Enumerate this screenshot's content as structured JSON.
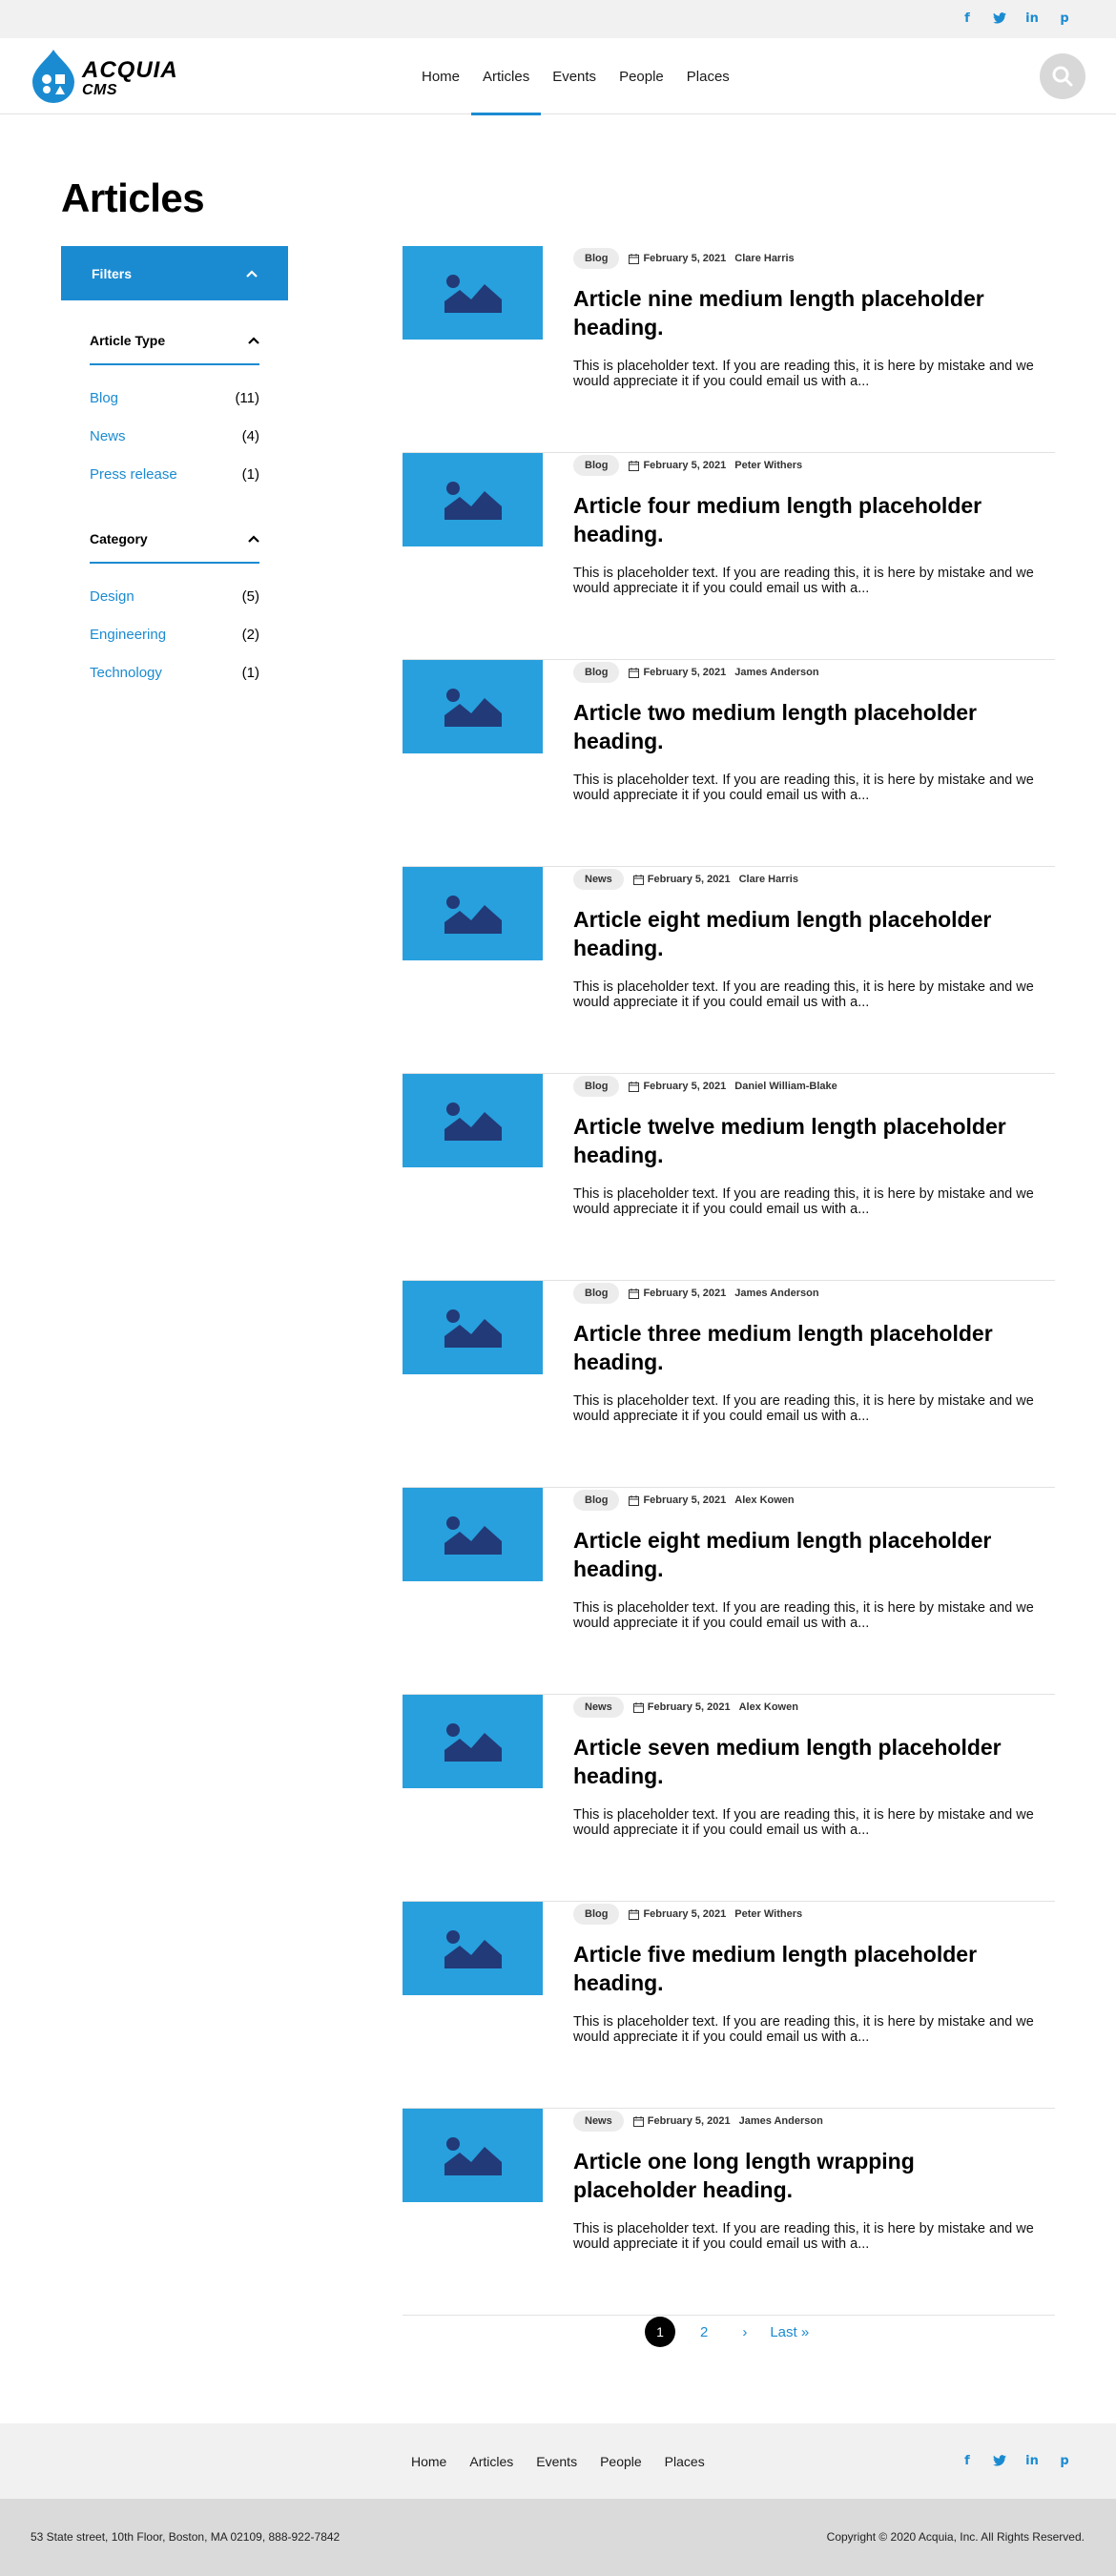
{
  "social": [
    "f",
    "t",
    "in",
    "p"
  ],
  "brand": {
    "line1": "ACQUIA",
    "line2": "CMS"
  },
  "nav": [
    "Home",
    "Articles",
    "Events",
    "People",
    "Places"
  ],
  "nav_active": "Articles",
  "page_title": "Articles",
  "filters": {
    "label": "Filters",
    "facets": [
      {
        "title": "Article Type",
        "items": [
          {
            "label": "Blog",
            "count": "(11)"
          },
          {
            "label": "News",
            "count": "(4)"
          },
          {
            "label": "Press release",
            "count": "(1)"
          }
        ]
      },
      {
        "title": "Category",
        "items": [
          {
            "label": "Design",
            "count": "(5)"
          },
          {
            "label": "Engineering",
            "count": "(2)"
          },
          {
            "label": "Technology",
            "count": "(1)"
          }
        ]
      }
    ]
  },
  "articles": [
    {
      "type": "Blog",
      "date": "February 5, 2021",
      "author": "Clare Harris",
      "title": "Article nine medium length placeholder heading.",
      "excerpt": "This is placeholder text. If you are reading this, it is here by mistake and we would appreciate it if you could email us with a..."
    },
    {
      "type": "Blog",
      "date": "February 5, 2021",
      "author": "Peter Withers",
      "title": "Article four medium length placeholder heading.",
      "excerpt": "This is placeholder text. If you are reading this, it is here by mistake and we would appreciate it if you could email us with a..."
    },
    {
      "type": "Blog",
      "date": "February 5, 2021",
      "author": "James Anderson",
      "title": "Article two medium length placeholder heading.",
      "excerpt": "This is placeholder text. If you are reading this, it is here by mistake and we would appreciate it if you could email us with a..."
    },
    {
      "type": "News",
      "date": "February 5, 2021",
      "author": "Clare Harris",
      "title": "Article eight medium length placeholder heading.",
      "excerpt": "This is placeholder text. If you are reading this, it is here by mistake and we would appreciate it if you could email us with a..."
    },
    {
      "type": "Blog",
      "date": "February 5, 2021",
      "author": "Daniel William-Blake",
      "title": "Article twelve medium length placeholder heading.",
      "excerpt": "This is placeholder text. If you are reading this, it is here by mistake and we would appreciate it if you could email us with a..."
    },
    {
      "type": "Blog",
      "date": "February 5, 2021",
      "author": "James Anderson",
      "title": "Article three medium length placeholder heading.",
      "excerpt": "This is placeholder text. If you are reading this, it is here by mistake and we would appreciate it if you could email us with a..."
    },
    {
      "type": "Blog",
      "date": "February 5, 2021",
      "author": "Alex Kowen",
      "title": "Article eight medium length placeholder heading.",
      "excerpt": "This is placeholder text. If you are reading this, it is here by mistake and we would appreciate it if you could email us with a..."
    },
    {
      "type": "News",
      "date": "February 5, 2021",
      "author": "Alex Kowen",
      "title": "Article seven medium length placeholder heading.",
      "excerpt": "This is placeholder text. If you are reading this, it is here by mistake and we would appreciate it if you could email us with a..."
    },
    {
      "type": "Blog",
      "date": "February 5, 2021",
      "author": "Peter Withers",
      "title": "Article five medium length placeholder heading.",
      "excerpt": "This is placeholder text. If you are reading this, it is here by mistake and we would appreciate it if you could email us with a..."
    },
    {
      "type": "News",
      "date": "February 5, 2021",
      "author": "James Anderson",
      "title": "Article one long length wrapping placeholder heading.",
      "excerpt": "This is placeholder text. If you are reading this, it is here by mistake and we would appreciate it if you could email us with a..."
    }
  ],
  "pagination": {
    "current": "1",
    "next_page": "2",
    "next_arrow": "›",
    "last": "Last »"
  },
  "footer": {
    "nav": [
      "Home",
      "Articles",
      "Events",
      "People",
      "Places"
    ],
    "address": "53 State street, 10th Floor, Boston, MA 02109, 888-922-7842",
    "copyright": "Copyright © 2020 Acquia, Inc. All Rights Reserved."
  },
  "colors": {
    "accent": "#1b8bd1",
    "thumb": "#27a0dd",
    "thumb_icon": "#223a78"
  }
}
